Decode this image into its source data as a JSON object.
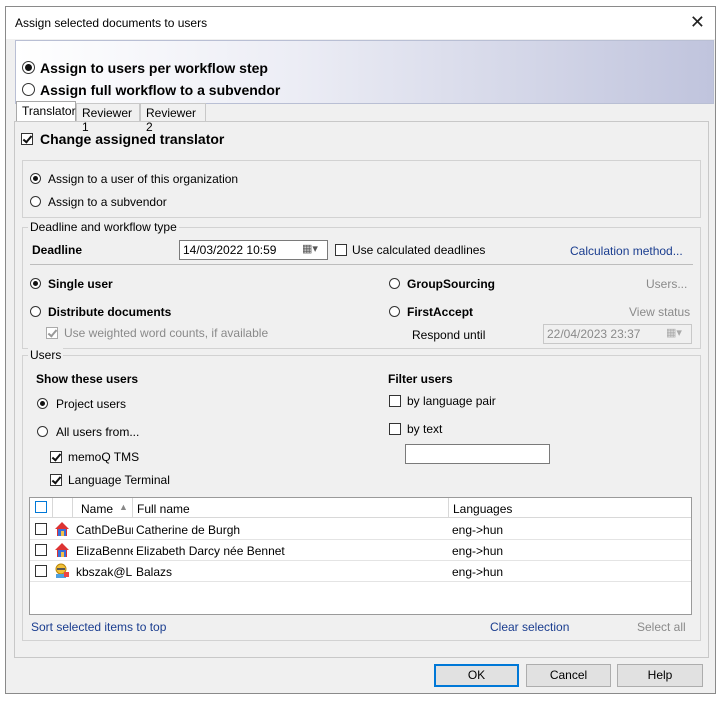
{
  "window": {
    "title": "Assign selected documents to users"
  },
  "assignment_mode": {
    "per_step_label": "Assign to users per workflow step",
    "full_workflow_label": "Assign full workflow to a subvendor",
    "selected": "per_step"
  },
  "tabs": [
    {
      "label": "Translator",
      "active": true
    },
    {
      "label": "Reviewer 1",
      "active": false
    },
    {
      "label": "Reviewer 2",
      "active": false
    }
  ],
  "change_assigned": {
    "label": "Change assigned translator",
    "checked": true
  },
  "assign_to": {
    "org_user_label": "Assign to a user of this organization",
    "subvendor_label": "Assign to a subvendor"
  },
  "deadline_group": {
    "title": "Deadline and workflow type",
    "deadline_label": "Deadline",
    "deadline_value": "14/03/2022 10:59",
    "use_calculated_label": "Use calculated deadlines",
    "calculation_link": "Calculation method...",
    "single_user_label": "Single user",
    "distribute_label": "Distribute documents",
    "weighted_label": "Use weighted word counts, if available",
    "groupsourcing_label": "GroupSourcing",
    "users_link": "Users...",
    "firstaccept_label": "FirstAccept",
    "view_status_link": "View status",
    "respond_until_label": "Respond until",
    "respond_until_value": "22/04/2023 23:37"
  },
  "users_group": {
    "title": "Users",
    "show_label": "Show these users",
    "project_users_label": "Project users",
    "all_users_label": "All users from...",
    "memoq_label": "memoQ TMS",
    "language_terminal_label": "Language Terminal",
    "filter_label": "Filter users",
    "by_language_pair_label": "by language pair",
    "by_text_label": "by text",
    "filter_text_value": ""
  },
  "table": {
    "columns": [
      "Name",
      "Full name",
      "Languages"
    ],
    "rows": [
      {
        "name": "CathDeBur",
        "full_name": "Catherine de Burgh",
        "languages": "eng->hun",
        "icon": "house-icon"
      },
      {
        "name": "ElizaBenne",
        "full_name": "Elizabeth Darcy née Bennet",
        "languages": "eng->hun",
        "icon": "house-icon"
      },
      {
        "name": "kbszak@L",
        "full_name": "Balazs",
        "languages": "eng->hun",
        "icon": "user-badge-icon"
      }
    ]
  },
  "table_actions": {
    "sort_link": "Sort selected items to top",
    "clear_link": "Clear selection",
    "select_all_link": "Select all"
  },
  "buttons": {
    "ok": "OK",
    "cancel": "Cancel",
    "help": "Help"
  },
  "colors": {
    "link": "#1a3d8f",
    "default_button_border": "#0078d7",
    "banner_accent": "#c0c4dd"
  }
}
